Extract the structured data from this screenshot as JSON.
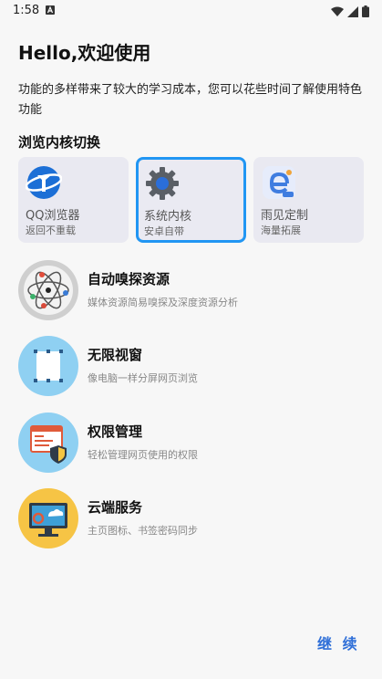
{
  "status_bar": {
    "time": "1:58"
  },
  "header": {
    "title": "Hello,欢迎使用",
    "description": "功能的多样带来了较大的学习成本，您可以花些时间了解使用特色功能"
  },
  "kernel_section": {
    "title": "浏览内核切换",
    "cards": [
      {
        "name": "QQ浏览器",
        "sub": "返回不重载",
        "selected": false
      },
      {
        "name": "系统内核",
        "sub": "安卓自带",
        "selected": true
      },
      {
        "name": "雨见定制",
        "sub": "海量拓展",
        "selected": false
      }
    ]
  },
  "features": [
    {
      "title": "自动嗅探资源",
      "sub": "媒体资源简易嗅探及深度资源分析",
      "icon": "atom-icon"
    },
    {
      "title": "无限视窗",
      "sub": "像电脑一样分屏网页浏览",
      "icon": "window-icon"
    },
    {
      "title": "权限管理",
      "sub": "轻松管理网页使用的权限",
      "icon": "shield-icon"
    },
    {
      "title": "云端服务",
      "sub": "主页图标、书签密码同步",
      "icon": "cloud-monitor-icon"
    }
  ],
  "footer": {
    "continue_label": "继 续"
  },
  "colors": {
    "accent": "#2196f3",
    "link": "#2f6fd8"
  }
}
